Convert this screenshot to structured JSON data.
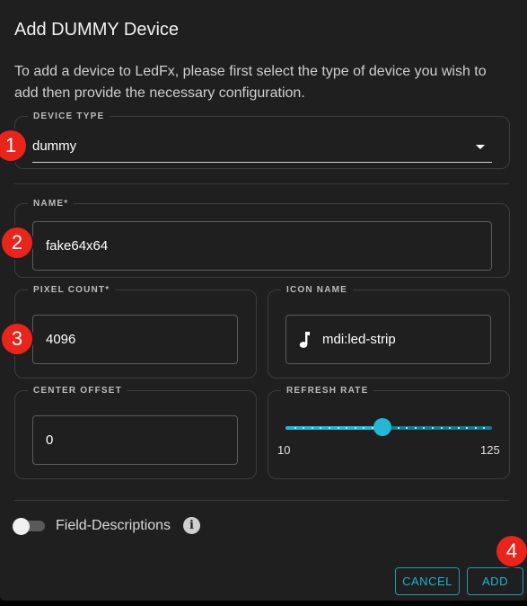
{
  "dialog": {
    "title": "Add DUMMY Device",
    "description": "To add a device to LedFx, please first select the type of device you wish to add then provide the necessary configuration."
  },
  "device_type": {
    "legend": "DEVICE TYPE",
    "value": "dummy"
  },
  "fields": {
    "name": {
      "legend": "NAME*",
      "value": "fake64x64"
    },
    "pixel_count": {
      "legend": "PIXEL COUNT*",
      "value": "4096"
    },
    "icon_name": {
      "legend": "ICON NAME",
      "value": "mdi:led-strip",
      "icon": "music-note-icon"
    },
    "center_offset": {
      "legend": "CENTER OFFSET",
      "value": "0"
    },
    "refresh_rate": {
      "legend": "REFRESH RATE",
      "min": "10",
      "max": "125",
      "min_value": 10,
      "max_value": 125,
      "value": 64
    }
  },
  "field_descriptions": {
    "label": "Field-Descriptions",
    "enabled": false
  },
  "actions": {
    "cancel": "CANCEL",
    "add": "ADD"
  },
  "annotations": [
    "1",
    "2",
    "3",
    "4"
  ],
  "colors": {
    "accent": "#22b8d6",
    "badge": "#e8241b",
    "background": "#1f1f20"
  }
}
